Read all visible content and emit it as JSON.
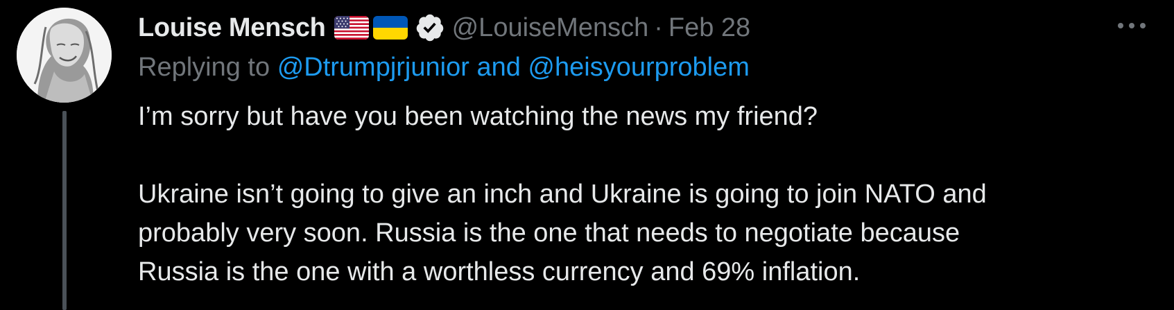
{
  "tweet": {
    "author": {
      "display_name": "Louise Mensch",
      "handle": "@LouiseMensch",
      "flags": [
        "us-flag-icon",
        "ukraine-flag-icon"
      ],
      "verified": true
    },
    "separator": "·",
    "date": "Feb 28",
    "reply": {
      "prefix": "Replying to",
      "mentions": [
        "@Dtrumpjrjunior",
        "@heisyourproblem"
      ],
      "conjunction": "and"
    },
    "body": {
      "paragraph_1": "I’m sorry but have you been watching the news my friend?",
      "paragraph_2_lines": [
        "Ukraine isn’t going to give an inch and Ukraine is going to join NATO and",
        "probably very soon. Russia is the one that needs to negotiate because",
        "Russia is the one with a worthless currency and 69% inflation."
      ]
    },
    "more_icon": "more-horizontal-icon"
  },
  "colors": {
    "background": "#000000",
    "primary_text": "#e7e9ea",
    "secondary_text": "#71767b",
    "link": "#1d9bf0",
    "thread_line": "#4a5158"
  }
}
